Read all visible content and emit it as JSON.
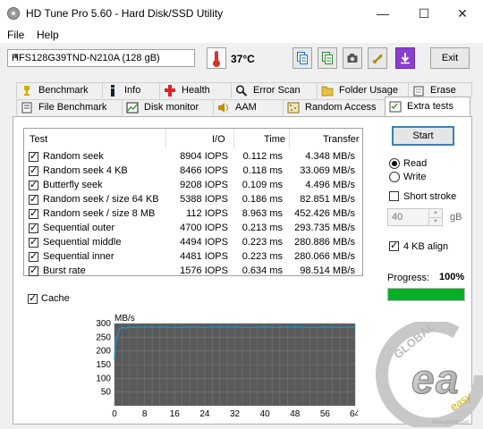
{
  "window": {
    "title": "HD Tune Pro 5.60 - Hard Disk/SSD Utility",
    "minimize": "—",
    "maximize": "☐",
    "close": "✕"
  },
  "menu": {
    "file": "File",
    "help": "Help"
  },
  "toolbar": {
    "drive": "HFS128G39TND-N210A (128 gB)",
    "temperature": "37°C",
    "exit": "Exit"
  },
  "tabs": {
    "row1": [
      {
        "label": "Benchmark",
        "icon": "benchmark-icon"
      },
      {
        "label": "Info",
        "icon": "info-icon"
      },
      {
        "label": "Health",
        "icon": "health-icon"
      },
      {
        "label": "Error Scan",
        "icon": "error-scan-icon"
      },
      {
        "label": "Folder Usage",
        "icon": "folder-icon"
      },
      {
        "label": "Erase",
        "icon": "erase-icon"
      }
    ],
    "row2": [
      {
        "label": "File Benchmark",
        "icon": "file-benchmark-icon"
      },
      {
        "label": "Disk monitor",
        "icon": "disk-monitor-icon"
      },
      {
        "label": "AAM",
        "icon": "speaker-icon"
      },
      {
        "label": "Random Access",
        "icon": "random-access-icon"
      },
      {
        "label": "Extra tests",
        "icon": "extra-tests-icon"
      }
    ],
    "active": "Extra tests"
  },
  "table": {
    "headers": [
      "Test",
      "I/O",
      "Time",
      "Transfer"
    ],
    "rows": [
      {
        "test": "Random seek",
        "io": "8904 IOPS",
        "time": "0.112 ms",
        "transfer": "4.348 MB/s",
        "checked": true
      },
      {
        "test": "Random seek 4 KB",
        "io": "8466 IOPS",
        "time": "0.118 ms",
        "transfer": "33.069 MB/s",
        "checked": true
      },
      {
        "test": "Butterfly seek",
        "io": "9208 IOPS",
        "time": "0.109 ms",
        "transfer": "4.496 MB/s",
        "checked": true
      },
      {
        "test": "Random seek / size 64 KB",
        "io": "5388 IOPS",
        "time": "0.186 ms",
        "transfer": "82.851 MB/s",
        "checked": true
      },
      {
        "test": "Random seek / size 8 MB",
        "io": "112 IOPS",
        "time": "8.963 ms",
        "transfer": "452.426 MB/s",
        "checked": true
      },
      {
        "test": "Sequential outer",
        "io": "4700 IOPS",
        "time": "0.213 ms",
        "transfer": "293.735 MB/s",
        "checked": true
      },
      {
        "test": "Sequential middle",
        "io": "4494 IOPS",
        "time": "0.223 ms",
        "transfer": "280.886 MB/s",
        "checked": true
      },
      {
        "test": "Sequential inner",
        "io": "4481 IOPS",
        "time": "0.223 ms",
        "transfer": "280.066 MB/s",
        "checked": true
      },
      {
        "test": "Burst rate",
        "io": "1576 IOPS",
        "time": "0.634 ms",
        "transfer": "98.514 MB/s",
        "checked": true
      }
    ]
  },
  "cache": {
    "label": "Cache",
    "checked": true
  },
  "controls": {
    "start": "Start",
    "read": "Read",
    "write": "Write",
    "mode": "read",
    "short_stroke": "Short stroke",
    "short_stroke_checked": false,
    "short_stroke_value": "40",
    "short_stroke_unit": "gB",
    "align_4kb": "4 KB align",
    "align_4kb_checked": true,
    "progress_label": "Progress:",
    "progress_value": "100%",
    "progress_fraction": 1.0
  },
  "chart_data": {
    "type": "line",
    "ylabel": "MB/s",
    "xlabel": "",
    "x_unit": "MB",
    "x_ticks": [
      "0",
      "8",
      "16",
      "24",
      "32",
      "40",
      "48",
      "56",
      "64MB"
    ],
    "y_ticks": [
      "300",
      "250",
      "200",
      "150",
      "100",
      "50"
    ],
    "xlim": [
      0,
      64
    ],
    "ylim": [
      0,
      300
    ],
    "grid": true,
    "series": [
      {
        "color": "#1e90c8",
        "x": [
          0,
          0.3,
          0.6,
          1,
          1.5,
          2,
          3,
          4,
          6,
          8,
          10,
          12,
          16,
          20,
          24,
          28,
          32,
          36,
          40,
          44,
          48,
          52,
          56,
          60,
          64
        ],
        "y": [
          170,
          230,
          250,
          270,
          282,
          286,
          283,
          287,
          285,
          288,
          286,
          287,
          286,
          287,
          286,
          288,
          287,
          286,
          287,
          286,
          288,
          286,
          287,
          286,
          287
        ]
      }
    ]
  },
  "watermark": {
    "text1": "GLOBAL",
    "text2": "easy",
    "url": "www.gecid.com"
  }
}
